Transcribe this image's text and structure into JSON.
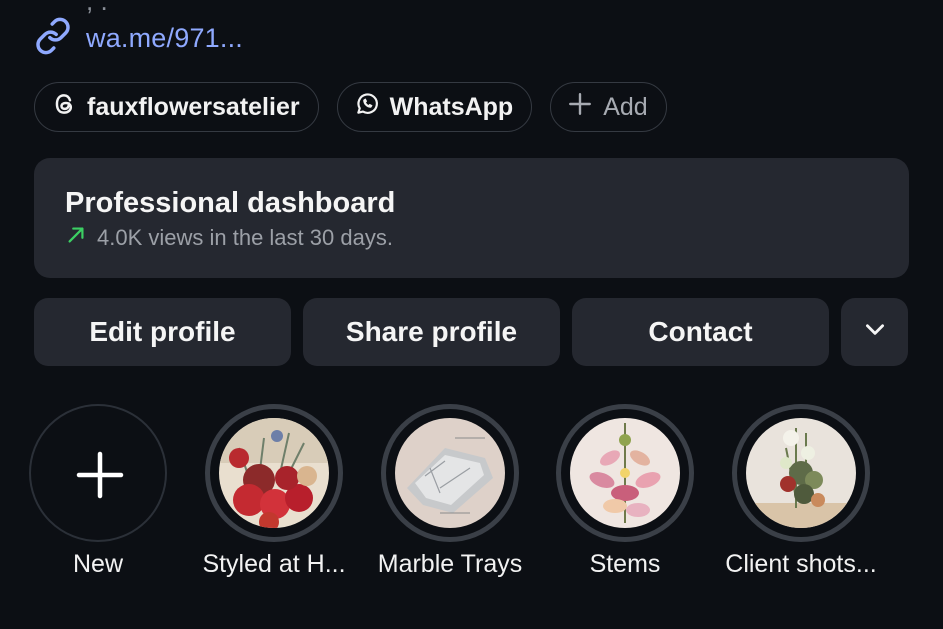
{
  "profile": {
    "link_text": "wa.me/971...",
    "partial_text": ", ."
  },
  "chips": [
    {
      "label": "fauxflowersatelier",
      "icon": "threads-icon"
    },
    {
      "label": "WhatsApp",
      "icon": "whatsapp-icon"
    },
    {
      "label": "Add",
      "icon": "plus-icon"
    }
  ],
  "dashboard": {
    "title": "Professional dashboard",
    "subtitle": "4.0K views in the last 30 days.",
    "trend_icon": "trend-up-arrow-icon",
    "trend_color": "#3ccf63"
  },
  "actions": {
    "edit": "Edit profile",
    "share": "Share profile",
    "contact": "Contact",
    "more_icon": "chevron-down-icon"
  },
  "highlights": [
    {
      "label": "New",
      "icon": "plus-icon"
    },
    {
      "label": "Styled at H..."
    },
    {
      "label": "Marble Trays"
    },
    {
      "label": "Stems"
    },
    {
      "label": "Client shots..."
    }
  ],
  "colors": {
    "background": "#0c0f14",
    "card": "#252830",
    "link": "#8fa9ff"
  }
}
